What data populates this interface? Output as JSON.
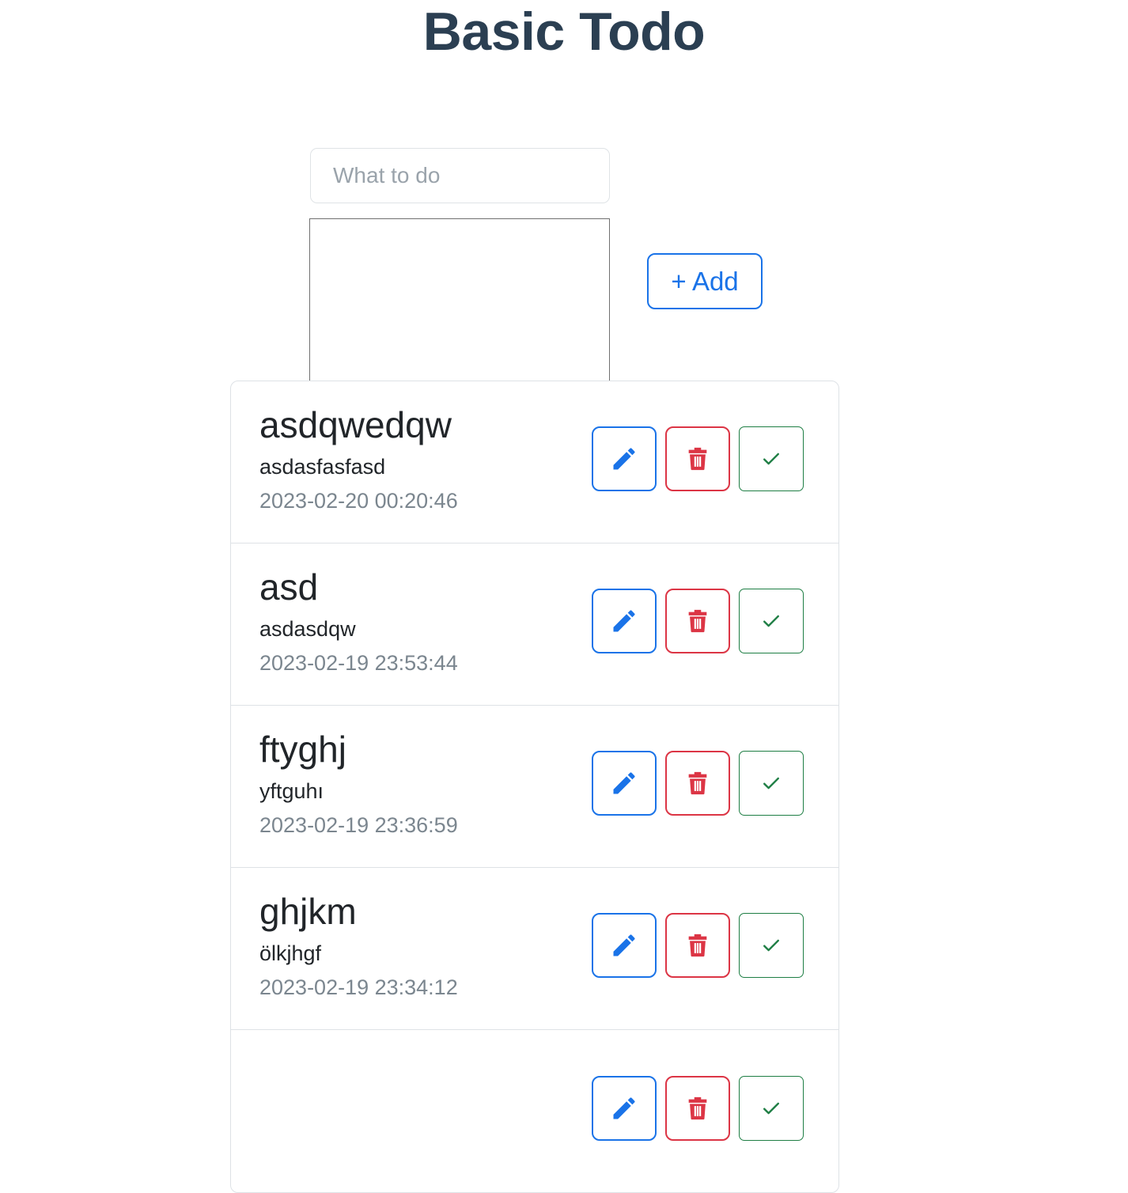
{
  "header": {
    "title": "Basic Todo"
  },
  "compose": {
    "title_input": {
      "placeholder": "What to do",
      "value": ""
    },
    "description_input": {
      "placeholder": "",
      "value": ""
    },
    "add_button_label": "+ Add"
  },
  "colors": {
    "heading": "#2b3f52",
    "accent_blue": "#1a73e8",
    "danger_red": "#dc3545",
    "success_green": "#1e7e44",
    "muted_text": "#7b868f",
    "border": "#dee2e6"
  },
  "actions": {
    "edit": {
      "icon": "pencil-icon",
      "label": "Edit"
    },
    "delete": {
      "icon": "trash-icon",
      "label": "Delete"
    },
    "complete": {
      "icon": "check-icon",
      "label": "Complete"
    }
  },
  "todos": [
    {
      "name": "asdqwedqw",
      "description": "asdasfasfasd",
      "date": "2023-02-20 00:20:46"
    },
    {
      "name": "asd",
      "description": "asdasdqw",
      "date": "2023-02-19 23:53:44"
    },
    {
      "name": "ftyghj",
      "description": "yftguhı",
      "date": "2023-02-19 23:36:59"
    },
    {
      "name": "ghjkm",
      "description": "ölkjhgf",
      "date": "2023-02-19 23:34:12"
    },
    {
      "name": "",
      "description": "",
      "date": ""
    }
  ]
}
